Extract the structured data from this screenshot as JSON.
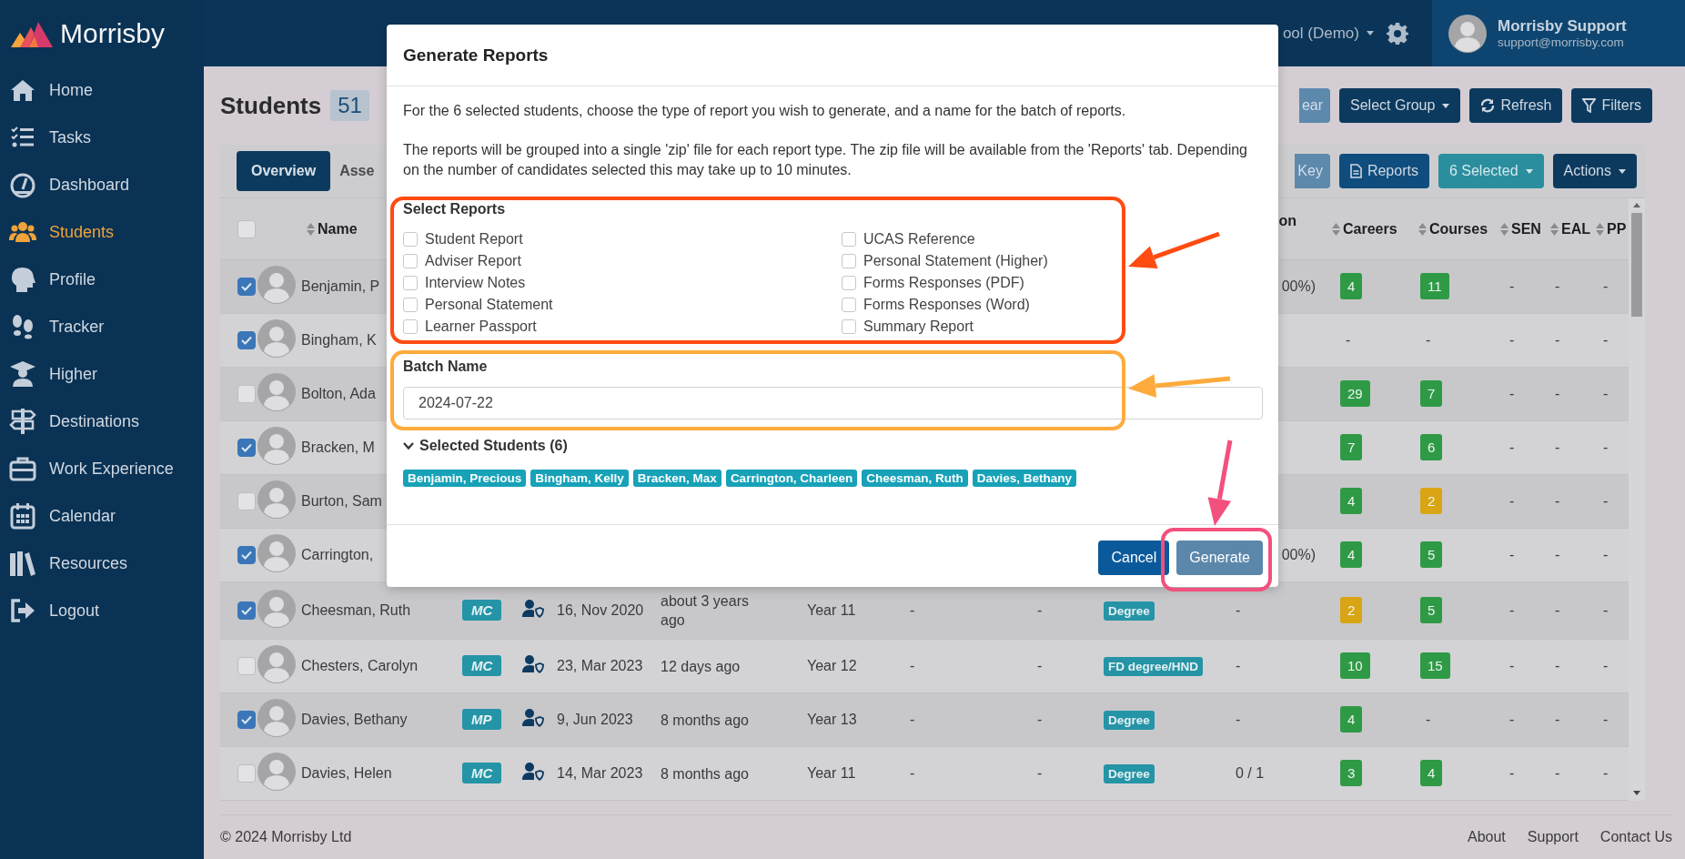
{
  "sidebar": {
    "logo": "Morrisby",
    "items": [
      {
        "label": "Home",
        "selected": false
      },
      {
        "label": "Tasks",
        "selected": false
      },
      {
        "label": "Dashboard",
        "selected": false
      },
      {
        "label": "Students",
        "selected": true
      },
      {
        "label": "Profile",
        "selected": false
      },
      {
        "label": "Tracker",
        "selected": false
      },
      {
        "label": "Higher",
        "selected": false
      },
      {
        "label": "Destinations",
        "selected": false
      },
      {
        "label": "Work Experience",
        "selected": false
      },
      {
        "label": "Calendar",
        "selected": false
      },
      {
        "label": "Resources",
        "selected": false
      },
      {
        "label": "Logout",
        "selected": false
      }
    ]
  },
  "topbar": {
    "school": "ool (Demo)",
    "user_name": "Morrisby Support",
    "user_email": "support@morrisby.com"
  },
  "page": {
    "title": "Students",
    "count": "51",
    "toolbar": [
      {
        "label": "ear",
        "kind": "cut",
        "caret": false
      },
      {
        "label": "Select Group",
        "kind": "dark",
        "caret": true
      },
      {
        "label": "Refresh",
        "kind": "dark",
        "caret": false
      },
      {
        "label": "Filters",
        "kind": "dark",
        "caret": false
      }
    ]
  },
  "tabs": [
    {
      "label": "Overview",
      "selected": true
    },
    {
      "label": "Asse",
      "selected": false
    }
  ],
  "table_actions": [
    {
      "label": "Key",
      "kind": "cut",
      "caret": false
    },
    {
      "label": "Reports",
      "kind": "blue",
      "caret": false
    },
    {
      "label": "6 Selected",
      "kind": "teal",
      "caret": true
    },
    {
      "label": "Actions",
      "kind": "dark",
      "caret": true
    }
  ],
  "table": {
    "select_all_checked": false,
    "columns": [
      {
        "label": "Name",
        "sortable": true
      },
      {
        "label": "on",
        "sortable": false
      },
      {
        "label": "Careers",
        "sortable": true
      },
      {
        "label": "Courses",
        "sortable": true
      },
      {
        "label": "SEN",
        "sortable": true
      },
      {
        "label": "EAL",
        "sortable": true
      },
      {
        "label": "PP",
        "sortable": true
      }
    ],
    "rows": [
      {
        "name": "Benjamin, P",
        "checked": true,
        "progress_end": "00%)",
        "careers": {
          "text": "4",
          "color": "#2f9a46"
        },
        "courses": {
          "text": "11",
          "color": "#2f9a46"
        },
        "sen": "-",
        "eal": "-",
        "pp": "-"
      },
      {
        "name": "Bingham, K",
        "checked": true,
        "careers": {
          "text": "-"
        },
        "courses": {
          "text": "-"
        },
        "sen": "-",
        "eal": "-",
        "pp": "-"
      },
      {
        "name": "Bolton, Ada",
        "checked": false,
        "careers": {
          "text": "29",
          "color": "#2f9a46"
        },
        "courses": {
          "text": "7",
          "color": "#2f9a46"
        },
        "sen": "-",
        "eal": "-",
        "pp": "-"
      },
      {
        "name": "Bracken, M",
        "checked": true,
        "careers": {
          "text": "7",
          "color": "#2f9a46"
        },
        "courses": {
          "text": "6",
          "color": "#2f9a46"
        },
        "sen": "-",
        "eal": "-",
        "pp": "-"
      },
      {
        "name": "Burton, Sam",
        "checked": false,
        "careers": {
          "text": "4",
          "color": "#2f9a46"
        },
        "courses": {
          "text": "2",
          "color": "#d9a515"
        },
        "sen": "-",
        "eal": "-",
        "pp": "-"
      },
      {
        "name": "Carrington,",
        "checked": true,
        "progress_end": "00%)",
        "careers": {
          "text": "4",
          "color": "#2f9a46"
        },
        "courses": {
          "text": "5",
          "color": "#2f9a46"
        },
        "sen": "-",
        "eal": "-",
        "pp": "-"
      },
      {
        "name": "Cheesman, Ruth",
        "checked": true,
        "type": "MC",
        "date": "16, Nov 2020",
        "last_seen": "about 3 years ago",
        "year": "Year 11",
        "col_9": "-",
        "col_10": "-",
        "tag": "Degree",
        "progress": "-",
        "careers": {
          "text": "2",
          "color": "#d9a515"
        },
        "courses": {
          "text": "5",
          "color": "#2f9a46"
        },
        "sen": "-",
        "eal": "-",
        "pp": "-"
      },
      {
        "name": "Chesters, Carolyn",
        "checked": false,
        "type": "MC",
        "date": "23, Mar 2023",
        "last_seen": "12 days ago",
        "year": "Year 12",
        "col_9": "-",
        "col_10": "-",
        "tag": "FD degree/HND",
        "progress": "-",
        "careers": {
          "text": "10",
          "color": "#2f9a46"
        },
        "courses": {
          "text": "15",
          "color": "#2f9a46"
        },
        "sen": "-",
        "eal": "-",
        "pp": "-"
      },
      {
        "name": "Davies, Bethany",
        "checked": true,
        "type": "MP",
        "date": "9, Jun 2023",
        "last_seen": "8 months ago",
        "year": "Year 13",
        "col_9": "-",
        "col_10": "-",
        "tag": "Degree",
        "progress": "-",
        "careers": {
          "text": "4",
          "color": "#2f9a46"
        },
        "courses": {
          "text": "-"
        },
        "sen": "-",
        "eal": "-",
        "pp": "-"
      },
      {
        "name": "Davies, Helen",
        "checked": false,
        "type": "MC",
        "date": "14, Mar 2023",
        "last_seen": "8 months ago",
        "year": "Year 11",
        "col_9": "-",
        "col_10": "-",
        "tag": "Degree",
        "progress": "0 / 1",
        "careers": {
          "text": "3",
          "color": "#2f9a46"
        },
        "courses": {
          "text": "4",
          "color": "#2f9a46"
        },
        "sen": "-",
        "eal": "-",
        "pp": "-"
      }
    ]
  },
  "footer": {
    "copyright": "© 2024 Morrisby Ltd",
    "links": [
      "About",
      "Support",
      "Contact Us"
    ]
  },
  "modal": {
    "title": "Generate Reports",
    "intro": "For the 6 selected students, choose the type of report you wish to generate, and a name for the batch of reports.",
    "note": "The reports will be grouped into a single 'zip' file for each report type. The zip file will be available from the 'Reports' tab. Depending on the number of candidates selected this may take up to 10 minutes.",
    "reports_label": "Select Reports",
    "reports": [
      {
        "label": "Student Report",
        "checked": false
      },
      {
        "label": "Adviser Report",
        "checked": false
      },
      {
        "label": "Interview Notes",
        "checked": false
      },
      {
        "label": "Personal Statement",
        "checked": false
      },
      {
        "label": "Learner Passport",
        "checked": false
      },
      {
        "label": "UCAS Reference",
        "checked": false
      },
      {
        "label": "Personal Statement (Higher)",
        "checked": false
      },
      {
        "label": "Forms Responses (PDF)",
        "checked": false
      },
      {
        "label": "Forms Responses (Word)",
        "checked": false
      },
      {
        "label": "Summary Report",
        "checked": false
      }
    ],
    "batch_label": "Batch Name",
    "batch_value": "2024-07-22",
    "selected_label": "Selected Students (6)",
    "expanded": true,
    "students": [
      "Benjamin, Precious",
      "Bingham, Kelly",
      "Bracken, Max",
      "Carrington, Charleen",
      "Cheesman, Ruth",
      "Davies, Bethany"
    ],
    "buttons": [
      {
        "label": "Cancel",
        "kind": "secondary"
      },
      {
        "label": "Generate",
        "kind": "primary"
      }
    ]
  },
  "annotations": [
    {
      "kind": "frame",
      "color": "#fe4b12"
    },
    {
      "kind": "arrow",
      "color": "#fe4b12"
    },
    {
      "kind": "frame",
      "color": "#fdab3d"
    },
    {
      "kind": "arrow",
      "color": "#fdab3d"
    },
    {
      "kind": "frame",
      "color": "#f4507d"
    },
    {
      "kind": "arrow",
      "color": "#f4507d"
    }
  ]
}
